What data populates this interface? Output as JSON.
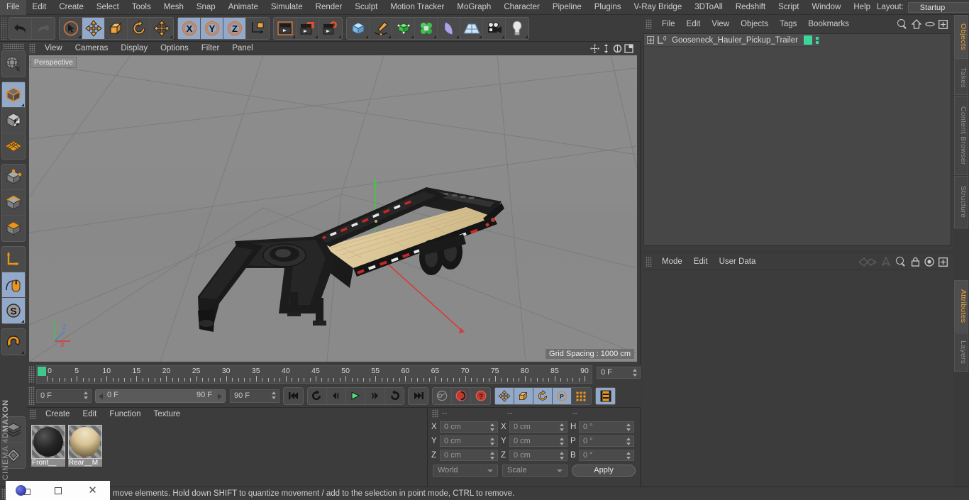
{
  "menubar": {
    "items": [
      "File",
      "Edit",
      "Create",
      "Select",
      "Tools",
      "Mesh",
      "Snap",
      "Animate",
      "Simulate",
      "Render",
      "Sculpt",
      "Motion Tracker",
      "MoGraph",
      "Character",
      "Pipeline",
      "Plugins",
      "V-Ray Bridge",
      "3DToAll",
      "Redshift",
      "Script",
      "Window",
      "Help"
    ],
    "layout_label": "Layout:",
    "layout_value": "Startup",
    "search_icon": "search-icon"
  },
  "toolbar": {
    "groups": [
      {
        "name": "undo-redo",
        "buttons": [
          {
            "name": "undo-button",
            "icon": "undo-arrow-icon",
            "selected": false
          },
          {
            "name": "redo-button",
            "icon": "redo-arrow-icon",
            "selected": false
          }
        ]
      },
      {
        "name": "transform-tools",
        "buttons": [
          {
            "name": "select-tool",
            "icon": "cursor-select-icon",
            "selected": false
          },
          {
            "name": "move-tool",
            "icon": "move-arrows-icon",
            "selected": true
          },
          {
            "name": "scale-tool",
            "icon": "scale-box-icon",
            "selected": false
          },
          {
            "name": "rotate-tool",
            "icon": "rotate-circle-icon",
            "selected": false
          },
          {
            "name": "dynamic-place-tool",
            "icon": "move-arrows-icon",
            "selected": false
          }
        ]
      },
      {
        "name": "axis-locks",
        "buttons": [
          {
            "name": "lock-x-axis",
            "icon": "x-axis-icon",
            "selected": true
          },
          {
            "name": "lock-y-axis",
            "icon": "y-axis-icon",
            "selected": true
          },
          {
            "name": "lock-z-axis",
            "icon": "z-axis-icon",
            "selected": true
          },
          {
            "name": "world-object-axis",
            "icon": "world-axis-icon",
            "selected": false
          }
        ]
      },
      {
        "name": "render-tools",
        "buttons": [
          {
            "name": "render-view-button",
            "icon": "clapperboard-icon",
            "selected": false
          },
          {
            "name": "render-to-picture-viewer-button",
            "icon": "clapperboard-picture-icon",
            "selected": false
          },
          {
            "name": "render-settings-button",
            "icon": "clapperboard-gear-icon",
            "selected": false
          }
        ]
      },
      {
        "name": "create-objects",
        "buttons": [
          {
            "name": "add-primitive-cube-button",
            "icon": "cube-icon",
            "selected": false
          },
          {
            "name": "add-spline-button",
            "icon": "pen-spline-icon",
            "selected": false
          },
          {
            "name": "add-generator-button",
            "icon": "green-cube-generator-icon",
            "selected": false
          },
          {
            "name": "add-deformer-button",
            "icon": "green-cluster-icon",
            "selected": false
          },
          {
            "name": "add-bend-button",
            "icon": "bend-deformer-icon",
            "selected": false
          },
          {
            "name": "add-floor-button",
            "icon": "floor-grid-icon",
            "selected": false
          },
          {
            "name": "add-camera-button",
            "icon": "camera-icon",
            "selected": false
          },
          {
            "name": "add-light-button",
            "icon": "lightbulb-icon",
            "selected": false
          }
        ]
      }
    ]
  },
  "left_toolbar": {
    "buttons": [
      {
        "name": "make-editable-button",
        "icon": "sphere-wire-icon",
        "selected": false
      },
      {
        "name": "model-mode-button",
        "icon": "model-cube-icon",
        "selected": true
      },
      {
        "name": "texture-mode-button",
        "icon": "texture-checker-cube-icon",
        "selected": false
      },
      {
        "name": "workplane-mode-button",
        "icon": "workplane-grid-icon",
        "selected": false
      },
      {
        "name": "points-mode-button",
        "icon": "points-cube-icon",
        "selected": false
      },
      {
        "name": "edges-mode-button",
        "icon": "edges-cube-icon",
        "selected": false
      },
      {
        "name": "polygons-mode-button",
        "icon": "polygons-cube-icon",
        "selected": false
      },
      {
        "name": "object-axis-mode-button",
        "icon": "axis-arrow-icon",
        "selected": false
      },
      {
        "name": "viewport-solo-button",
        "icon": "mouse-icon",
        "selected": true
      },
      {
        "name": "enable-snapping-button",
        "icon": "snap-s-icon",
        "selected": true
      },
      {
        "name": "magnet-tool-button",
        "icon": "magnet-icon",
        "selected": false
      },
      {
        "name": "layers-button",
        "icon": "layers-stack-icon",
        "selected": false
      },
      {
        "name": "structure-button",
        "icon": "structure-diamond-icon",
        "selected": false
      }
    ],
    "brand_line1": "MAXON",
    "brand_line2": "CINEMA 4D"
  },
  "viewport": {
    "menu_items": [
      "View",
      "Cameras",
      "Display",
      "Options",
      "Filter",
      "Panel"
    ],
    "view_label": "Perspective",
    "grid_spacing": "Grid Spacing : 1000 cm",
    "axis_labels": {
      "x": "X",
      "y": "Y",
      "z": "Z"
    },
    "corner_icons": [
      "pan-view-icon",
      "dolly-view-icon",
      "rotate-view-icon",
      "maximize-view-icon"
    ],
    "scene_description": "Gooseneck hauler pickup trailer 3D model on grey grid"
  },
  "timeline": {
    "tick_labels": [
      "0",
      "5",
      "10",
      "15",
      "20",
      "25",
      "30",
      "35",
      "40",
      "45",
      "50",
      "55",
      "60",
      "65",
      "70",
      "75",
      "80",
      "85",
      "90"
    ],
    "current_frame_field": "0 F",
    "start_frame": "0 F",
    "range_start": "0 F",
    "range_end": "90 F",
    "end_frame": "90 F"
  },
  "animbar": {
    "transport": [
      {
        "name": "go-to-start-button",
        "icon": "skip-start-icon",
        "selected": false
      },
      {
        "name": "previous-key-button",
        "icon": "previous-key-icon",
        "selected": false
      },
      {
        "name": "step-back-button",
        "icon": "step-back-icon",
        "selected": false
      },
      {
        "name": "play-button",
        "icon": "play-triangle-icon",
        "selected": false
      },
      {
        "name": "step-forward-button",
        "icon": "step-forward-icon",
        "selected": false
      },
      {
        "name": "next-key-button",
        "icon": "next-key-icon",
        "selected": false
      },
      {
        "name": "go-to-end-button",
        "icon": "skip-end-icon",
        "selected": false
      }
    ],
    "record": [
      {
        "name": "record-active-objects-button",
        "icon": "key-record-icon",
        "selected": false
      },
      {
        "name": "autokeying-button",
        "icon": "red-circle-record-icon",
        "selected": false
      },
      {
        "name": "keyframe-selection-button",
        "icon": "red-question-icon",
        "selected": false
      }
    ],
    "keyflags": [
      {
        "name": "position-key-button",
        "icon": "move-arrows-icon",
        "selected": true
      },
      {
        "name": "scale-key-button",
        "icon": "scale-box-icon",
        "selected": true
      },
      {
        "name": "rotation-key-button",
        "icon": "rotate-circle-icon",
        "selected": true
      },
      {
        "name": "parameter-key-button",
        "icon": "param-p-icon",
        "selected": true
      },
      {
        "name": "point-level-animation-button",
        "icon": "dots-grid-icon",
        "selected": false
      }
    ],
    "timeline_toggle": {
      "name": "timeline-button",
      "icon": "film-strip-icon",
      "selected": true
    }
  },
  "material_panel": {
    "menu_items": [
      "Create",
      "Edit",
      "Function",
      "Texture"
    ],
    "materials": [
      {
        "name": "Front__",
        "full": "Front_Material",
        "swatch": "#2a2a2a",
        "selected": true
      },
      {
        "name": "Rear__M",
        "full": "Rear__Material",
        "swatch": "#d8c49a",
        "selected": true
      }
    ]
  },
  "coordinates": {
    "header_dashes": [
      "--",
      "--",
      "--"
    ],
    "rows": [
      {
        "pos_label": "X",
        "pos_value": "0 cm",
        "size_label": "X",
        "size_value": "0 cm",
        "rot_label": "H",
        "rot_value": "0 °"
      },
      {
        "pos_label": "Y",
        "pos_value": "0 cm",
        "size_label": "Y",
        "size_value": "0 cm",
        "rot_label": "P",
        "rot_value": "0 °"
      },
      {
        "pos_label": "Z",
        "pos_value": "0 cm",
        "size_label": "Z",
        "size_value": "0 cm",
        "rot_label": "B",
        "rot_value": "0 °"
      }
    ],
    "coord_system": "World",
    "mode": "Scale",
    "apply_label": "Apply"
  },
  "object_manager": {
    "menu_items": [
      "File",
      "Edit",
      "View",
      "Objects",
      "Tags",
      "Bookmarks"
    ],
    "header_icons": [
      "search-icon",
      "home-icon",
      "ellipse-icon",
      "expand-icon"
    ],
    "objects": [
      {
        "name": "Gooseneck_Hauler_Pickup_Trailer",
        "layer_badge": "0",
        "tag_color": "#3bd69a"
      }
    ]
  },
  "attribute_manager": {
    "menu_items": [
      "Mode",
      "Edit",
      "User Data"
    ],
    "header_icons": [
      "animate-curve-icon",
      "pin-icon",
      "search-icon",
      "lock-icon",
      "target-icon",
      "expand-icon"
    ]
  },
  "dock_tabs": {
    "top": [
      {
        "label": "Objects",
        "active": true
      },
      {
        "label": "Takes",
        "active": false
      },
      {
        "label": "Content Browser",
        "active": false
      },
      {
        "label": "Structure",
        "active": false
      }
    ],
    "bottom": [
      {
        "label": "Attributes",
        "active": true
      },
      {
        "label": "Layers",
        "active": false
      }
    ]
  },
  "status_bar": {
    "text": "move elements. Hold down SHIFT to quantize movement / add to the selection in point mode, CTRL to remove."
  },
  "window_overlay": {
    "restore_icon": "restore-window-icon",
    "maximize_icon": "maximize-window-icon",
    "close_icon": "close-window-icon"
  }
}
